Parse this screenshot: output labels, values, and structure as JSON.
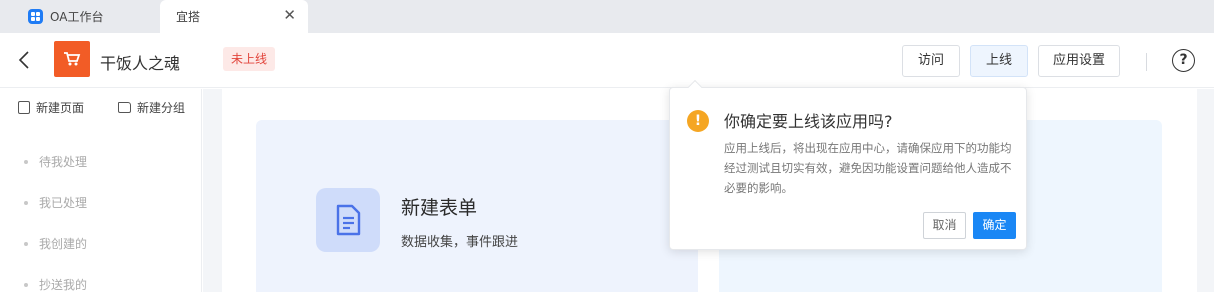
{
  "tabs": [
    {
      "label": "OA工作台",
      "active": false
    },
    {
      "label": "宜搭",
      "active": true
    }
  ],
  "header": {
    "app_name": "干饭人之魂",
    "status": "未上线",
    "buttons": {
      "visit": "访问",
      "publish": "上线",
      "settings": "应用设置"
    },
    "help": "?"
  },
  "sidebar": {
    "actions": {
      "new_page": "新建页面",
      "new_group": "新建分组"
    },
    "items": [
      "待我处理",
      "我已处理",
      "我创建的",
      "抄送我的"
    ]
  },
  "main": {
    "card": {
      "title": "新建表单",
      "subtitle": "数据收集，事件跟进"
    }
  },
  "popconfirm": {
    "title": "你确定要上线该应用吗?",
    "body": "应用上线后，将出现在应用中心，请确保应用下的功能均经过测试且切实有效，避免因功能设置问题给他人造成不必要的影响。",
    "cancel": "取消",
    "ok": "确定"
  },
  "colors": {
    "accent": "#1a87f5",
    "logo": "#f25c26",
    "warning": "#f5a623",
    "status": "#e2453c"
  }
}
